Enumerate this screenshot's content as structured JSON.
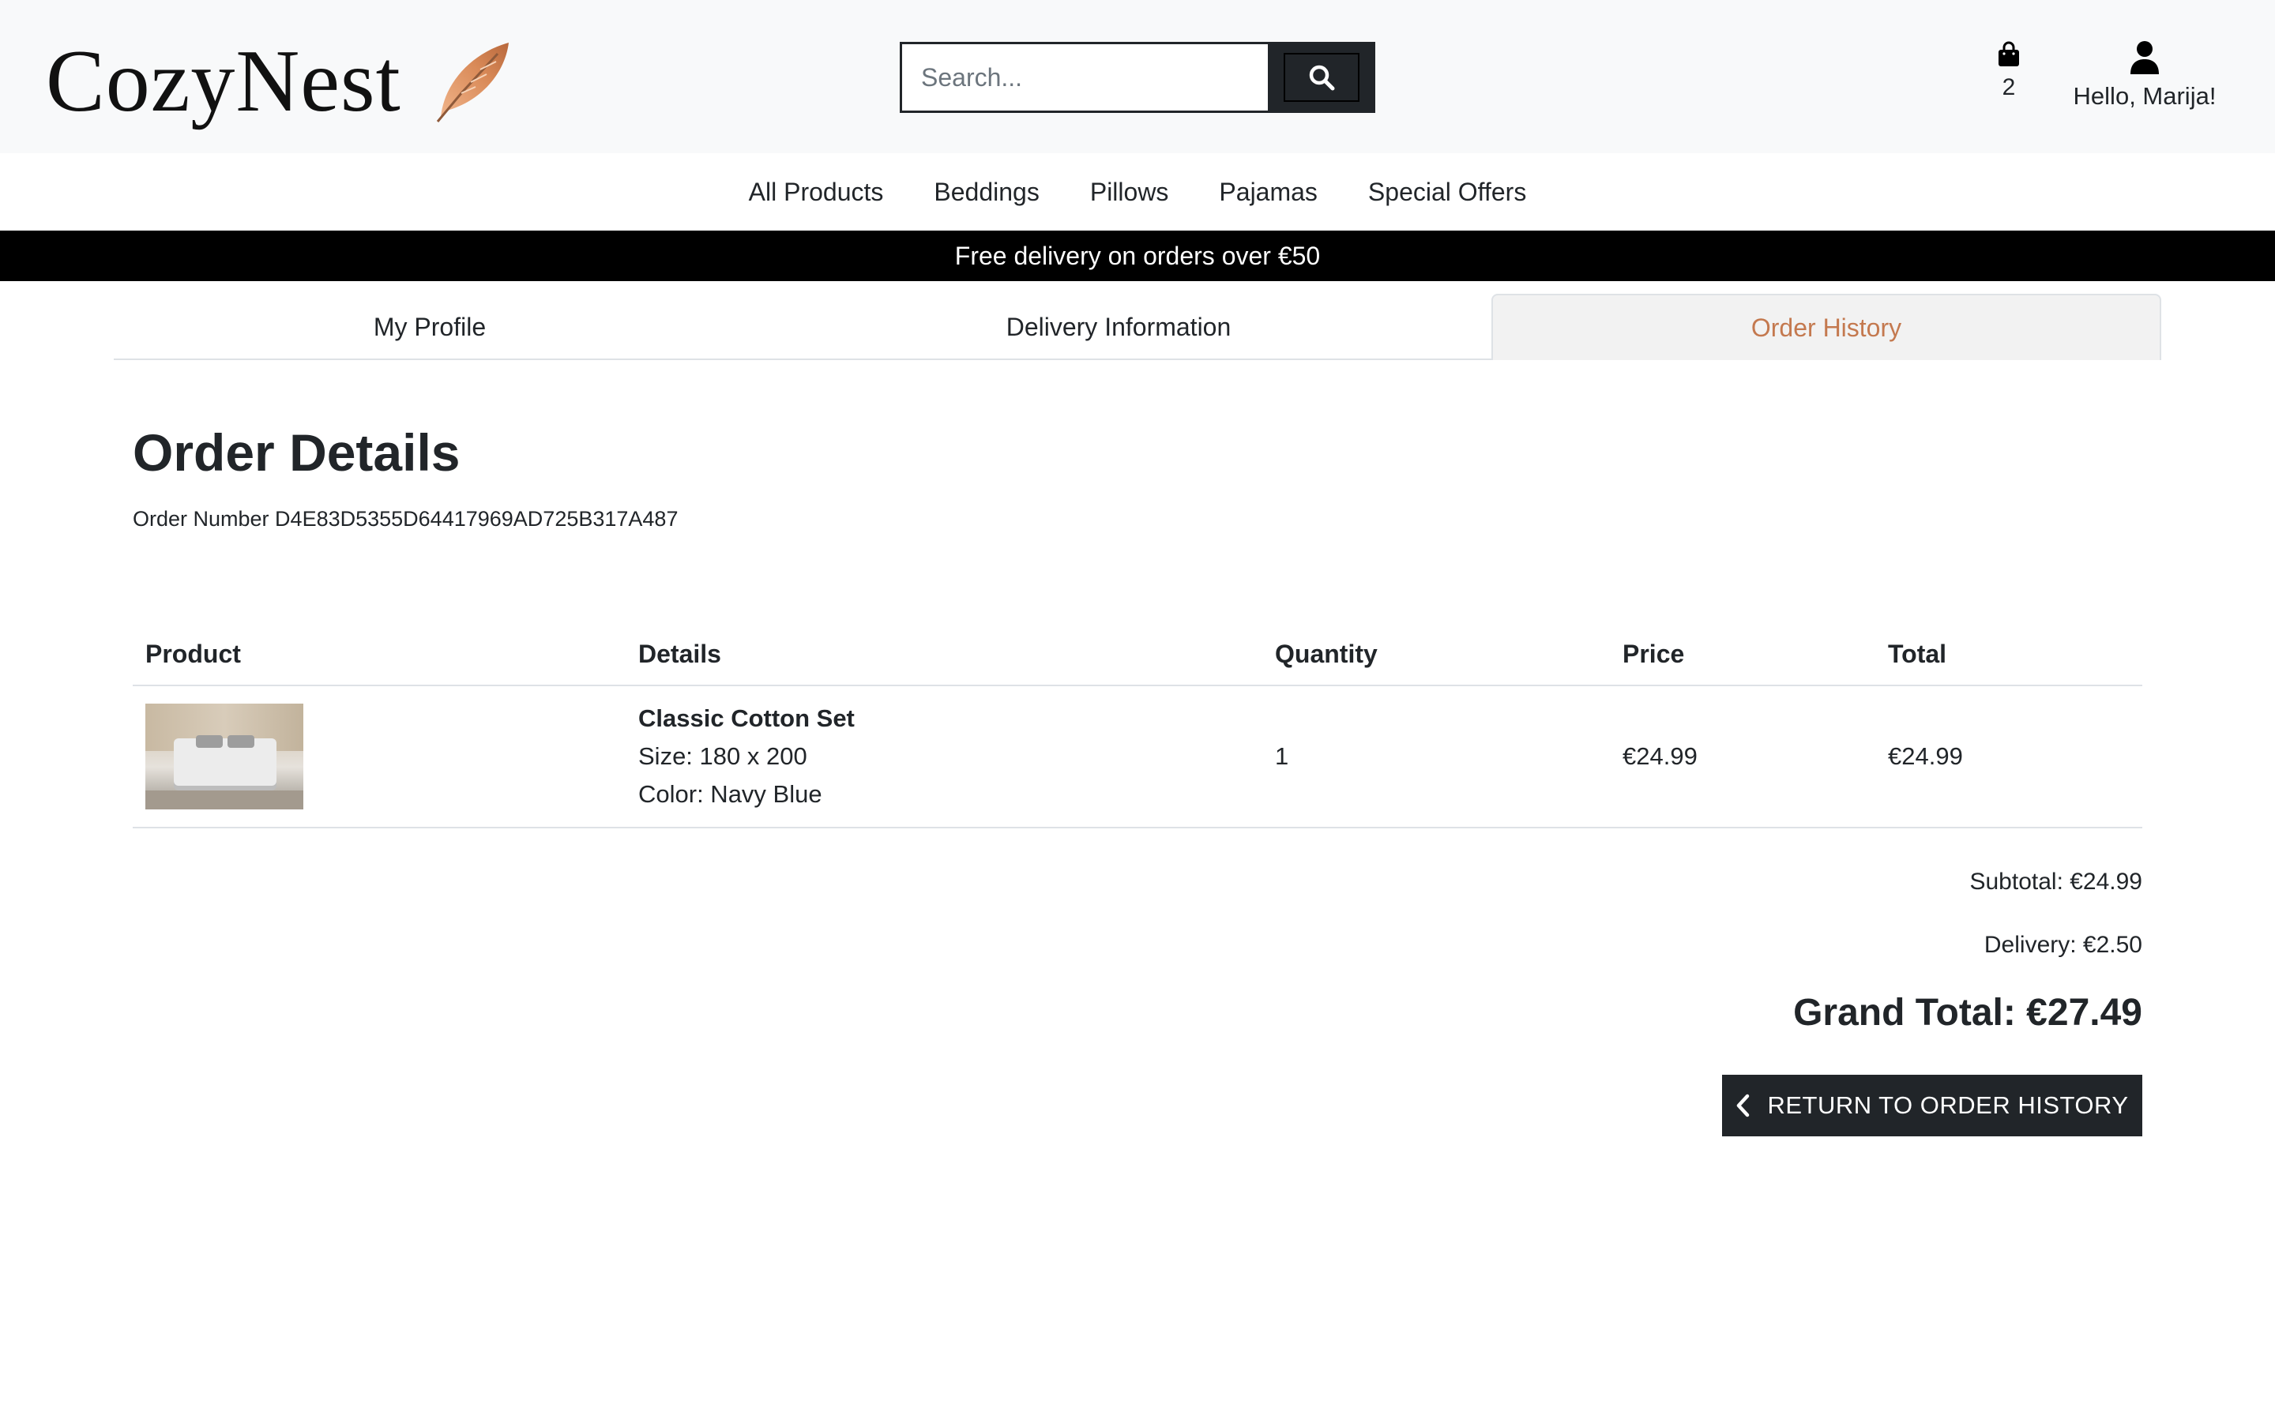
{
  "header": {
    "logo_text": "CozyNest",
    "search_placeholder": "Search...",
    "cart_count": "2",
    "account_greeting": "Hello, Marija!"
  },
  "nav": {
    "items": [
      "All Products",
      "Beddings",
      "Pillows",
      "Pajamas",
      "Special Offers"
    ]
  },
  "banner": {
    "text": "Free delivery on orders over €50"
  },
  "tabs": {
    "items": [
      "My Profile",
      "Delivery Information",
      "Order History"
    ],
    "active": "Order History"
  },
  "order": {
    "title": "Order Details",
    "number_text": "Order Number D4E83D5355D64417969AD725B317A487"
  },
  "table": {
    "headers": [
      "Product",
      "Details",
      "Quantity",
      "Price",
      "Total"
    ],
    "rows": [
      {
        "name": "Classic Cotton Set",
        "size": "Size: 180 x 200",
        "color": "Color: Navy Blue",
        "quantity": "1",
        "price": "€24.99",
        "total": "€24.99"
      }
    ]
  },
  "summary": {
    "subtotal": "Subtotal: €24.99",
    "delivery": "Delivery: €2.50",
    "grand_total": "Grand Total: €27.49"
  },
  "actions": {
    "return_label": "RETURN TO ORDER HISTORY"
  },
  "colors": {
    "accent": "#c4794f",
    "dark": "#212529",
    "header_bg": "#f8f9fa"
  }
}
